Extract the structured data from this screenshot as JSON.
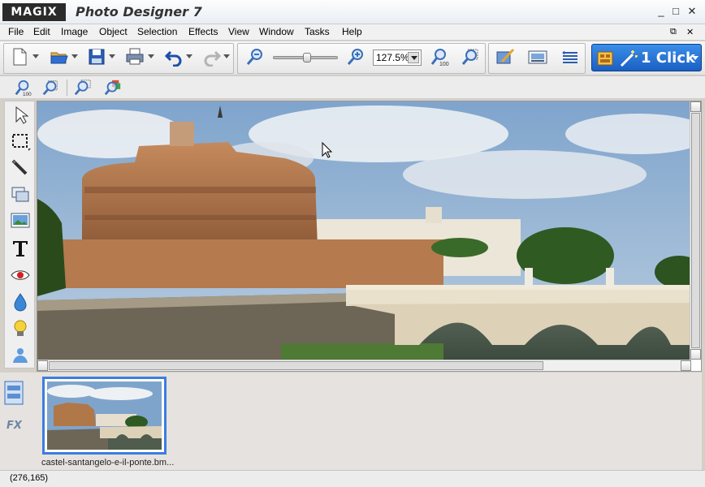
{
  "app": {
    "logo": "MAGIX",
    "title": "Photo Designer 7"
  },
  "window_controls": {
    "minimize": "_",
    "maximize": "□",
    "close": "✕"
  },
  "menu": {
    "items": [
      "File",
      "Edit",
      "Image",
      "Object",
      "Selection",
      "Effects",
      "View",
      "Window",
      "Tasks",
      "Help"
    ],
    "doc_controls": {
      "restore": "⧉",
      "close": "✕"
    }
  },
  "toolbar": {
    "zoom_value": "127.5%",
    "zoom_slider_level": 0.5,
    "one_click_label": "1 Click"
  },
  "canvas": {
    "cursor": "pointer-icon"
  },
  "thumbnails": [
    {
      "caption": "castel-santangelo-e-il-ponte.bm..."
    }
  ],
  "status": {
    "coords": "(276,165)"
  },
  "colors": {
    "accent": "#3b7ddd",
    "one_click": "#1b5fc4"
  }
}
